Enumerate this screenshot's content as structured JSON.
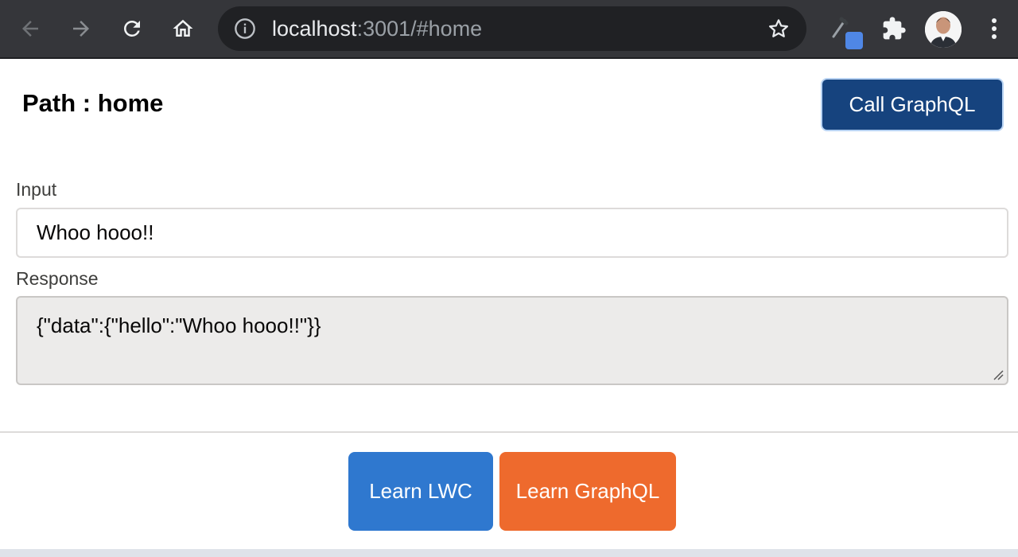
{
  "browser": {
    "url_host": "localhost",
    "url_rest": ":3001/#home",
    "icons": {
      "back": "back-arrow-icon",
      "forward": "forward-arrow-icon",
      "reload": "reload-icon",
      "home": "home-icon",
      "info": "info-icon",
      "bookmark": "star-icon",
      "eyedropper_ext": "eyedropper-icon",
      "extensions": "puzzle-icon",
      "menu": "kebab-menu-icon"
    }
  },
  "page": {
    "path_title": "Path : home",
    "call_button": "Call GraphQL",
    "input_label": "Input",
    "input_value": "Whoo hooo!!",
    "response_label": "Response",
    "response_value": "{\"data\":{\"hello\":\"Whoo hooo!!\"}}",
    "learn_lwc": "Learn LWC",
    "learn_graphql": "Learn GraphQL"
  },
  "colors": {
    "call_button": "#16437e",
    "learn_lwc": "#2f78cf",
    "learn_graphql": "#ee6a2d",
    "response_bg": "#ecebea"
  }
}
